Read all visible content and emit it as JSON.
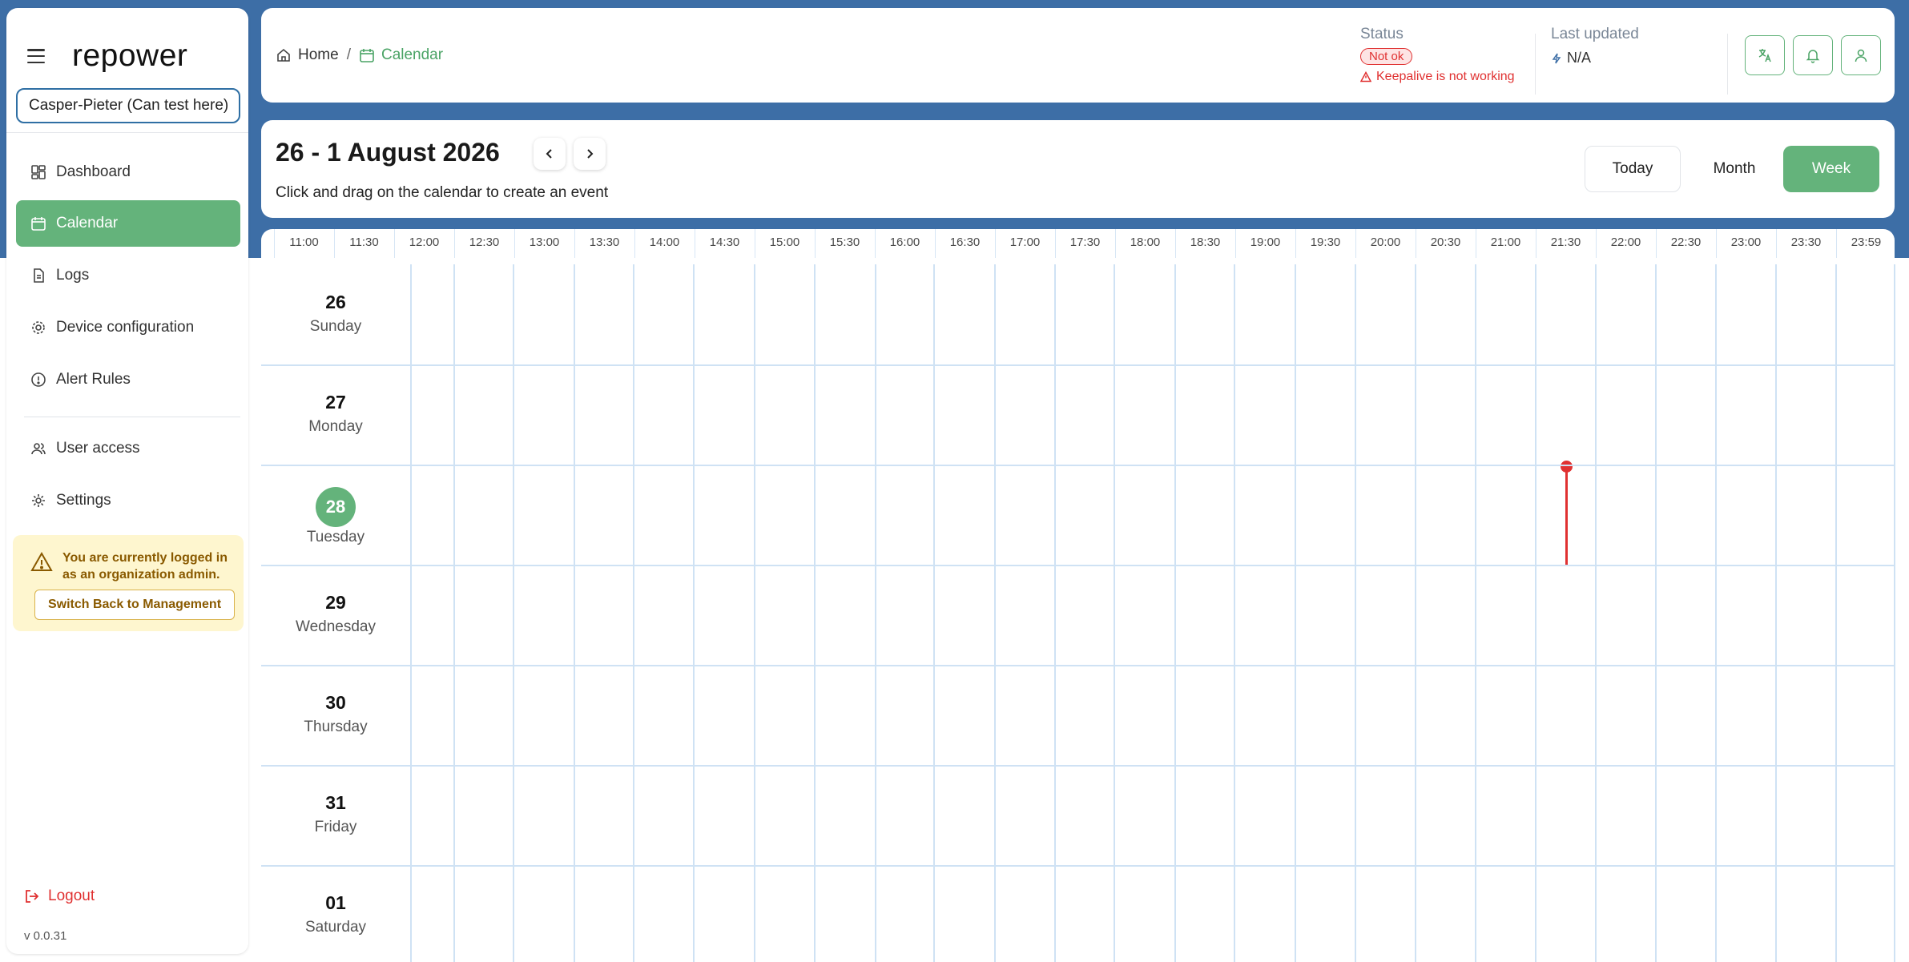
{
  "app": {
    "logo": "repower",
    "version": "v 0.0.31"
  },
  "sidebar": {
    "org_select_value": "Casper-Pieter (Can test here)",
    "items": [
      {
        "label": "Dashboard",
        "icon": "dashboard-icon"
      },
      {
        "label": "Calendar",
        "icon": "calendar-icon"
      },
      {
        "label": "Logs",
        "icon": "file-icon"
      },
      {
        "label": "Device configuration",
        "icon": "gear-icon"
      },
      {
        "label": "Alert Rules",
        "icon": "alert-circle-icon"
      },
      {
        "label": "User access",
        "icon": "users-icon"
      },
      {
        "label": "Settings",
        "icon": "settings-icon"
      }
    ],
    "active_item": "Calendar",
    "admin_notice": "You are currently logged in as an organization admin.",
    "switch_back_label": "Switch Back to Management",
    "logout_label": "Logout"
  },
  "header": {
    "breadcrumb_home": "Home",
    "breadcrumb_separator": "/",
    "breadcrumb_current": "Calendar",
    "status_label": "Status",
    "status_badge": "Not ok",
    "status_message": "Keepalive is not working",
    "last_updated_label": "Last updated",
    "last_updated_value": "N/A",
    "buttons": [
      "translate-icon",
      "bell-icon",
      "user-icon"
    ]
  },
  "calendar": {
    "range_title": "26 - 1 August 2026",
    "hint": "Click and drag on the calendar to create an event",
    "today_label": "Today",
    "month_label": "Month",
    "week_label": "Week",
    "active_view": "Week",
    "times": [
      "11:00",
      "11:30",
      "12:00",
      "12:30",
      "13:00",
      "13:30",
      "14:00",
      "14:30",
      "15:00",
      "15:30",
      "16:00",
      "16:30",
      "17:00",
      "17:30",
      "18:00",
      "18:30",
      "19:00",
      "19:30",
      "20:00",
      "20:30",
      "21:00",
      "21:30",
      "22:00",
      "22:30",
      "23:00",
      "23:30",
      "23:59"
    ],
    "days": [
      {
        "num": "26",
        "name": "Sunday",
        "today": false
      },
      {
        "num": "27",
        "name": "Monday",
        "today": false
      },
      {
        "num": "28",
        "name": "Tuesday",
        "today": true
      },
      {
        "num": "29",
        "name": "Wednesday",
        "today": false
      },
      {
        "num": "30",
        "name": "Thursday",
        "today": false
      },
      {
        "num": "31",
        "name": "Friday",
        "today": false
      },
      {
        "num": "01",
        "name": "Saturday",
        "today": false
      }
    ],
    "now_time": "21:30"
  },
  "colors": {
    "brand_blue": "#3d6ea6",
    "accent_green": "#64b37b",
    "error_red": "#e03131",
    "grid_blue": "#cfe2f4"
  }
}
